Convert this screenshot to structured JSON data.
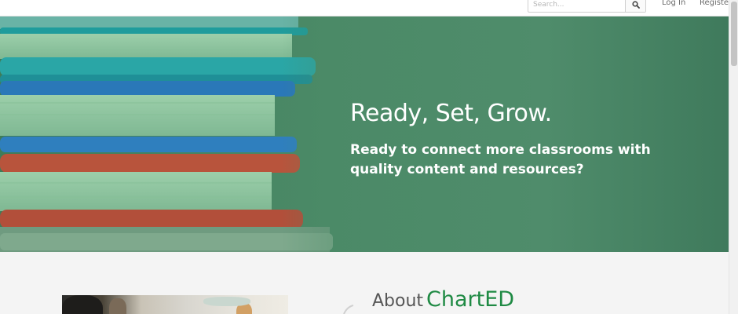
{
  "header": {
    "search": {
      "placeholder": "Search...",
      "value": ""
    },
    "nav": {
      "login": "Log In",
      "register": "Register"
    }
  },
  "hero": {
    "title": "Ready, Set, Grow.",
    "subtitle": "Ready to connect more classrooms with quality content and resources?"
  },
  "about": {
    "heading_prefix": "About",
    "brand_name": "ChartED"
  },
  "icons": {
    "search": "search-icon"
  },
  "colors": {
    "hero_green": "#4b8a67",
    "brand_green": "#1f8a44",
    "book_teal": "#2aa6a6",
    "book_blue": "#2a78b8",
    "book_red": "#b8543c",
    "page_green": "#8fc5a0"
  }
}
